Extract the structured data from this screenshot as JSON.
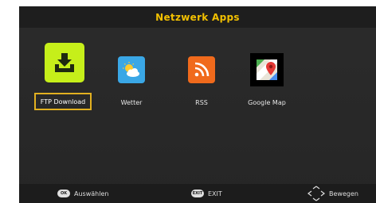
{
  "header": {
    "title": "Netzwerk Apps"
  },
  "apps": [
    {
      "label": "FTP Download",
      "icon": "download-tray-icon",
      "color": "#c6ef1a",
      "selected": true
    },
    {
      "label": "Wetter",
      "icon": "weather-icon",
      "color": "#3aa7e6",
      "selected": false
    },
    {
      "label": "RSS",
      "icon": "rss-icon",
      "color": "#f06a1c",
      "selected": false
    },
    {
      "label": "Google Map",
      "icon": "google-map-icon",
      "color": "#000000",
      "selected": false
    }
  ],
  "footer": {
    "ok_key": "OK",
    "ok_label": "Auswählen",
    "exit_key": "EXIT",
    "exit_label": "EXIT",
    "move_label": "Bewegen"
  },
  "colors": {
    "accent": "#f2c000",
    "selection_border": "#e2b020",
    "background": "#282828"
  }
}
